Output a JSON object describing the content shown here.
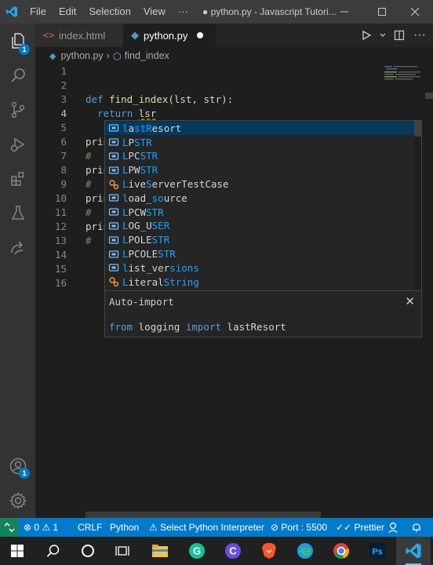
{
  "titlebar": {
    "menu": [
      "File",
      "Edit",
      "Selection",
      "View",
      "···"
    ],
    "title": "● python.py - Javascript Tutori...",
    "minimize_icon": "minimize-icon",
    "maximize_icon": "maximize-icon",
    "close_icon": "close-icon"
  },
  "activity": {
    "explorer_badge": "1",
    "accounts_badge": "1"
  },
  "tabs": [
    {
      "label": "index.html",
      "icon": "html-file-icon"
    },
    {
      "label": "python.py",
      "icon": "python-file-icon",
      "dirty": true
    }
  ],
  "breadcrumb": {
    "file": "python.py",
    "symbol": "find_index"
  },
  "editor": {
    "line_numbers": [
      "1",
      "2",
      "3",
      "4",
      "5",
      "6",
      "7",
      "8",
      "9",
      "10",
      "11",
      "12",
      "13",
      "14",
      "15",
      "16"
    ],
    "lines": {
      "l3_kw": "def",
      "l3_fn": "find_index",
      "l3_rest": "(lst, str):",
      "l4_kw": "return",
      "l4_text": "lsr",
      "l6": "prin",
      "l7": "#",
      "l8": "prin",
      "l9": "#",
      "l10": "prin",
      "l11": "#",
      "l12": "prin",
      "l13": "#"
    }
  },
  "suggest": {
    "items": [
      {
        "pre": "",
        "m1": "l",
        "mid": "a",
        "m2": "st",
        "m3": "R",
        "post": "esort",
        "kind": "variable"
      },
      {
        "pre": "",
        "m1": "L",
        "mid": "P",
        "m2": "S",
        "m3": "TR",
        "post": "",
        "kind": "variable"
      },
      {
        "pre": "",
        "m1": "L",
        "mid": "PC",
        "m2": "S",
        "m3": "TR",
        "post": "",
        "kind": "variable"
      },
      {
        "pre": "",
        "m1": "L",
        "mid": "PW",
        "m2": "S",
        "m3": "TR",
        "post": "",
        "kind": "variable"
      },
      {
        "pre": "",
        "m1": "L",
        "mid": "ive",
        "m2": "S",
        "m3": "er",
        "post": "verTestCase",
        "kind": "class"
      },
      {
        "pre": "",
        "m1": "l",
        "mid": "oad_",
        "m2": "s",
        "m3": "o",
        "post": "urce",
        "kind": "variable"
      },
      {
        "pre": "",
        "m1": "L",
        "mid": "PCW",
        "m2": "S",
        "m3": "TR",
        "post": "",
        "kind": "variable"
      },
      {
        "pre": "",
        "m1": "L",
        "mid": "OG_U",
        "m2": "S",
        "m3": "ER",
        "post": "",
        "kind": "variable"
      },
      {
        "pre": "",
        "m1": "L",
        "mid": "POLE",
        "m2": "S",
        "m3": "TR",
        "post": "",
        "kind": "variable"
      },
      {
        "pre": "",
        "m1": "L",
        "mid": "PCOLE",
        "m2": "S",
        "m3": "TR",
        "post": "",
        "kind": "variable"
      },
      {
        "pre": "",
        "m1": "l",
        "mid": "ist_ver",
        "m2": "s",
        "m3": "ions",
        "post": "",
        "kind": "variable"
      },
      {
        "pre": "",
        "m1": "L",
        "mid": "iteral",
        "m2": "S",
        "m3": "tring",
        "post": "",
        "kind": "class"
      }
    ],
    "detail_title": "Auto-import",
    "detail_from": "from",
    "detail_module": "logging",
    "detail_import": "import",
    "detail_name": "lastResort"
  },
  "statusbar": {
    "errors": "0",
    "warnings": "1",
    "eol": "CRLF",
    "language": "Python",
    "interpreter": "Select Python Interpreter",
    "port": "Port : 5500",
    "prettier": "Prettier"
  },
  "taskbar": {
    "apps": [
      "windows-start-icon",
      "search-icon",
      "cortana-icon",
      "task-view-icon",
      "file-explorer-icon",
      "grammarly-icon",
      "cursive-icon",
      "brave-icon",
      "edge-icon",
      "chrome-icon",
      "photoshop-icon",
      "vscode-icon"
    ]
  },
  "colors": {
    "accent": "#007acc",
    "keyword": "#569cd6",
    "function": "#dcdcaa",
    "match": "#18a3ff"
  }
}
